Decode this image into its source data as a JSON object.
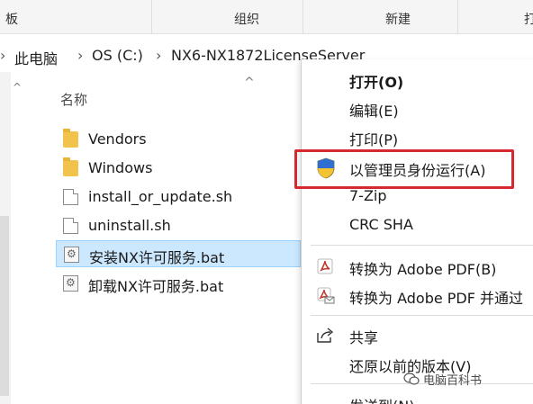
{
  "ribbon": {
    "groups": [
      "板",
      "组织",
      "新建",
      "打"
    ]
  },
  "address_bar": {
    "crumbs": [
      "此电脑",
      "OS (C:)",
      "NX6-NX1872LicenseServer"
    ]
  },
  "file_list": {
    "column_header": "名称",
    "items": [
      {
        "name": "Vendors",
        "type": "folder"
      },
      {
        "name": "Windows",
        "type": "folder"
      },
      {
        "name": "install_or_update.sh",
        "type": "file"
      },
      {
        "name": "uninstall.sh",
        "type": "file"
      },
      {
        "name": "安装NX许可服务.bat",
        "type": "bat",
        "selected": true
      },
      {
        "name": "卸载NX许可服务.bat",
        "type": "bat"
      }
    ]
  },
  "context_menu": {
    "items": [
      {
        "label": "打开(O)",
        "bold": true
      },
      {
        "label": "编辑(E)"
      },
      {
        "label": "打印(P)"
      },
      {
        "label": "以管理员身份运行(A)",
        "icon": "uac-shield-icon",
        "highlighted": true
      },
      {
        "label": "7-Zip"
      },
      {
        "label": "CRC SHA"
      },
      {
        "label": "转换为 Adobe PDF(B)",
        "icon": "adobe-pdf-icon"
      },
      {
        "label": "转换为 Adobe PDF 并通过",
        "icon": "adobe-pdf-mail-icon"
      },
      {
        "label": "共享",
        "icon": "share-icon"
      },
      {
        "label": "还原以前的版本(V)"
      },
      {
        "label": "发送到(N)"
      }
    ]
  },
  "watermark": {
    "text": "电脑百科书"
  },
  "colors": {
    "selection_fill": "#cce8ff",
    "selection_border": "#99d1ff",
    "highlight_box": "#d7282f",
    "folder": "#f1c24c"
  }
}
